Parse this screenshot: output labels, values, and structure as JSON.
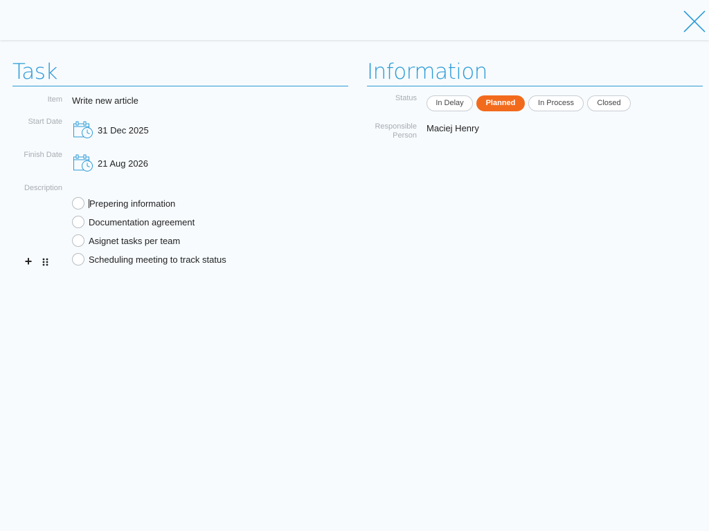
{
  "header": {
    "close_icon": "close-icon"
  },
  "task": {
    "title": "Task",
    "item_label": "Item",
    "item_value": "Write new article",
    "start_date_label": "Start Date",
    "start_date_value": "31 Dec 2025",
    "finish_date_label": "Finish Date",
    "finish_date_value": "21 Aug 2026",
    "description_label": "Description",
    "checklist": [
      {
        "text": "Prepering information",
        "checked": false
      },
      {
        "text": "Documentation agreement",
        "checked": false
      },
      {
        "text": "Asignet tasks per team",
        "checked": false
      },
      {
        "text": "Scheduling meeting to track status",
        "checked": false
      }
    ],
    "add_icon": "plus-icon",
    "drag_icon": "drag-handle-icon"
  },
  "information": {
    "title": "Information",
    "status_label": "Status",
    "statuses": [
      "In Delay",
      "Planned",
      "In Process",
      "Closed"
    ],
    "active_status": "Planned",
    "responsible_label_line1": "Responsible",
    "responsible_label_line2": "Person",
    "responsible_value": "Maciej Henry"
  },
  "colors": {
    "accent": "#2d9bd6",
    "active_status": "#f26b1d",
    "background": "#f7fbfe"
  }
}
